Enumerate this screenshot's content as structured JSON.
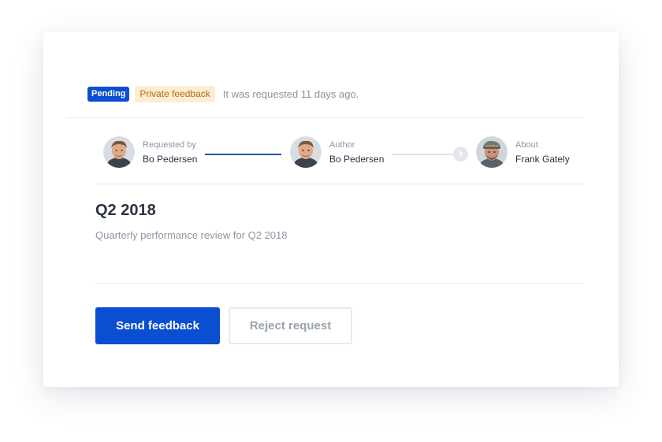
{
  "status": {
    "pending_badge": "Pending",
    "type_badge": "Private feedback",
    "requested_text": "It was requested 11 days ago."
  },
  "flow": {
    "requested_by": {
      "role": "Requested by",
      "name": "Bo Pedersen",
      "avatar": "avatar-bo"
    },
    "author": {
      "role": "Author",
      "name": "Bo Pedersen",
      "avatar": "avatar-bo"
    },
    "about": {
      "role": "About",
      "name": "Frank Gately",
      "avatar": "avatar-frank"
    },
    "arrow_icon": "chevron-right-icon"
  },
  "content": {
    "title": "Q2 2018",
    "description": "Quarterly performance review for Q2 2018"
  },
  "actions": {
    "send_label": "Send feedback",
    "reject_label": "Reject request"
  },
  "colors": {
    "primary": "#0b4ed1",
    "badge_private_bg": "#fdecd6",
    "badge_private_text": "#b86a08",
    "connector_active": "#1c4fae"
  }
}
